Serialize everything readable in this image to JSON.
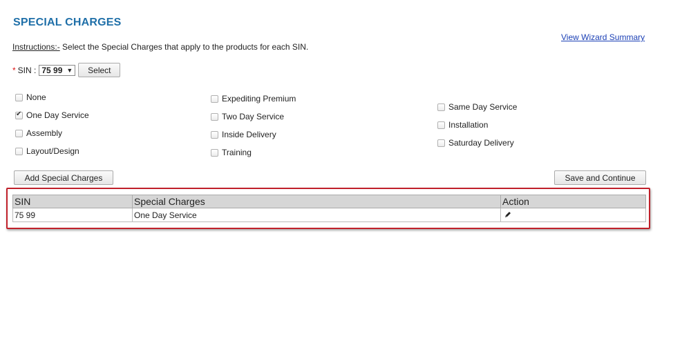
{
  "page": {
    "title": "SPECIAL CHARGES",
    "wizard_link": "View Wizard Summary",
    "instructions_label": "Instructions:-",
    "instructions_text": " Select the Special Charges that apply to the products for each SIN."
  },
  "sin": {
    "required_mark": "*",
    "label": "SIN :",
    "selected_value": "75 99",
    "select_button": "Select"
  },
  "options": {
    "col1": [
      {
        "label": "None",
        "checked": false
      },
      {
        "label": "One Day Service",
        "checked": true
      },
      {
        "label": "Assembly",
        "checked": false
      },
      {
        "label": "Layout/Design",
        "checked": false
      }
    ],
    "col2": [
      {
        "label": "Expediting Premium",
        "checked": false
      },
      {
        "label": "Two Day Service",
        "checked": false
      },
      {
        "label": "Inside Delivery",
        "checked": false
      },
      {
        "label": "Training",
        "checked": false
      }
    ],
    "col3": [
      {
        "label": "Same Day Service",
        "checked": false
      },
      {
        "label": "Installation",
        "checked": false
      },
      {
        "label": "Saturday Delivery",
        "checked": false
      }
    ]
  },
  "buttons": {
    "add": "Add Special Charges",
    "save": "Save and Continue"
  },
  "table": {
    "headers": [
      "SIN",
      "Special Charges",
      "Action"
    ],
    "rows": [
      {
        "sin": "75 99",
        "charge": "One Day Service",
        "action_icon": "pencil-icon"
      }
    ]
  },
  "colors": {
    "title": "#1f6fa8",
    "link": "#1a3fb5",
    "highlight_border": "#c0202a",
    "table_header_bg": "#d6d6d6"
  }
}
